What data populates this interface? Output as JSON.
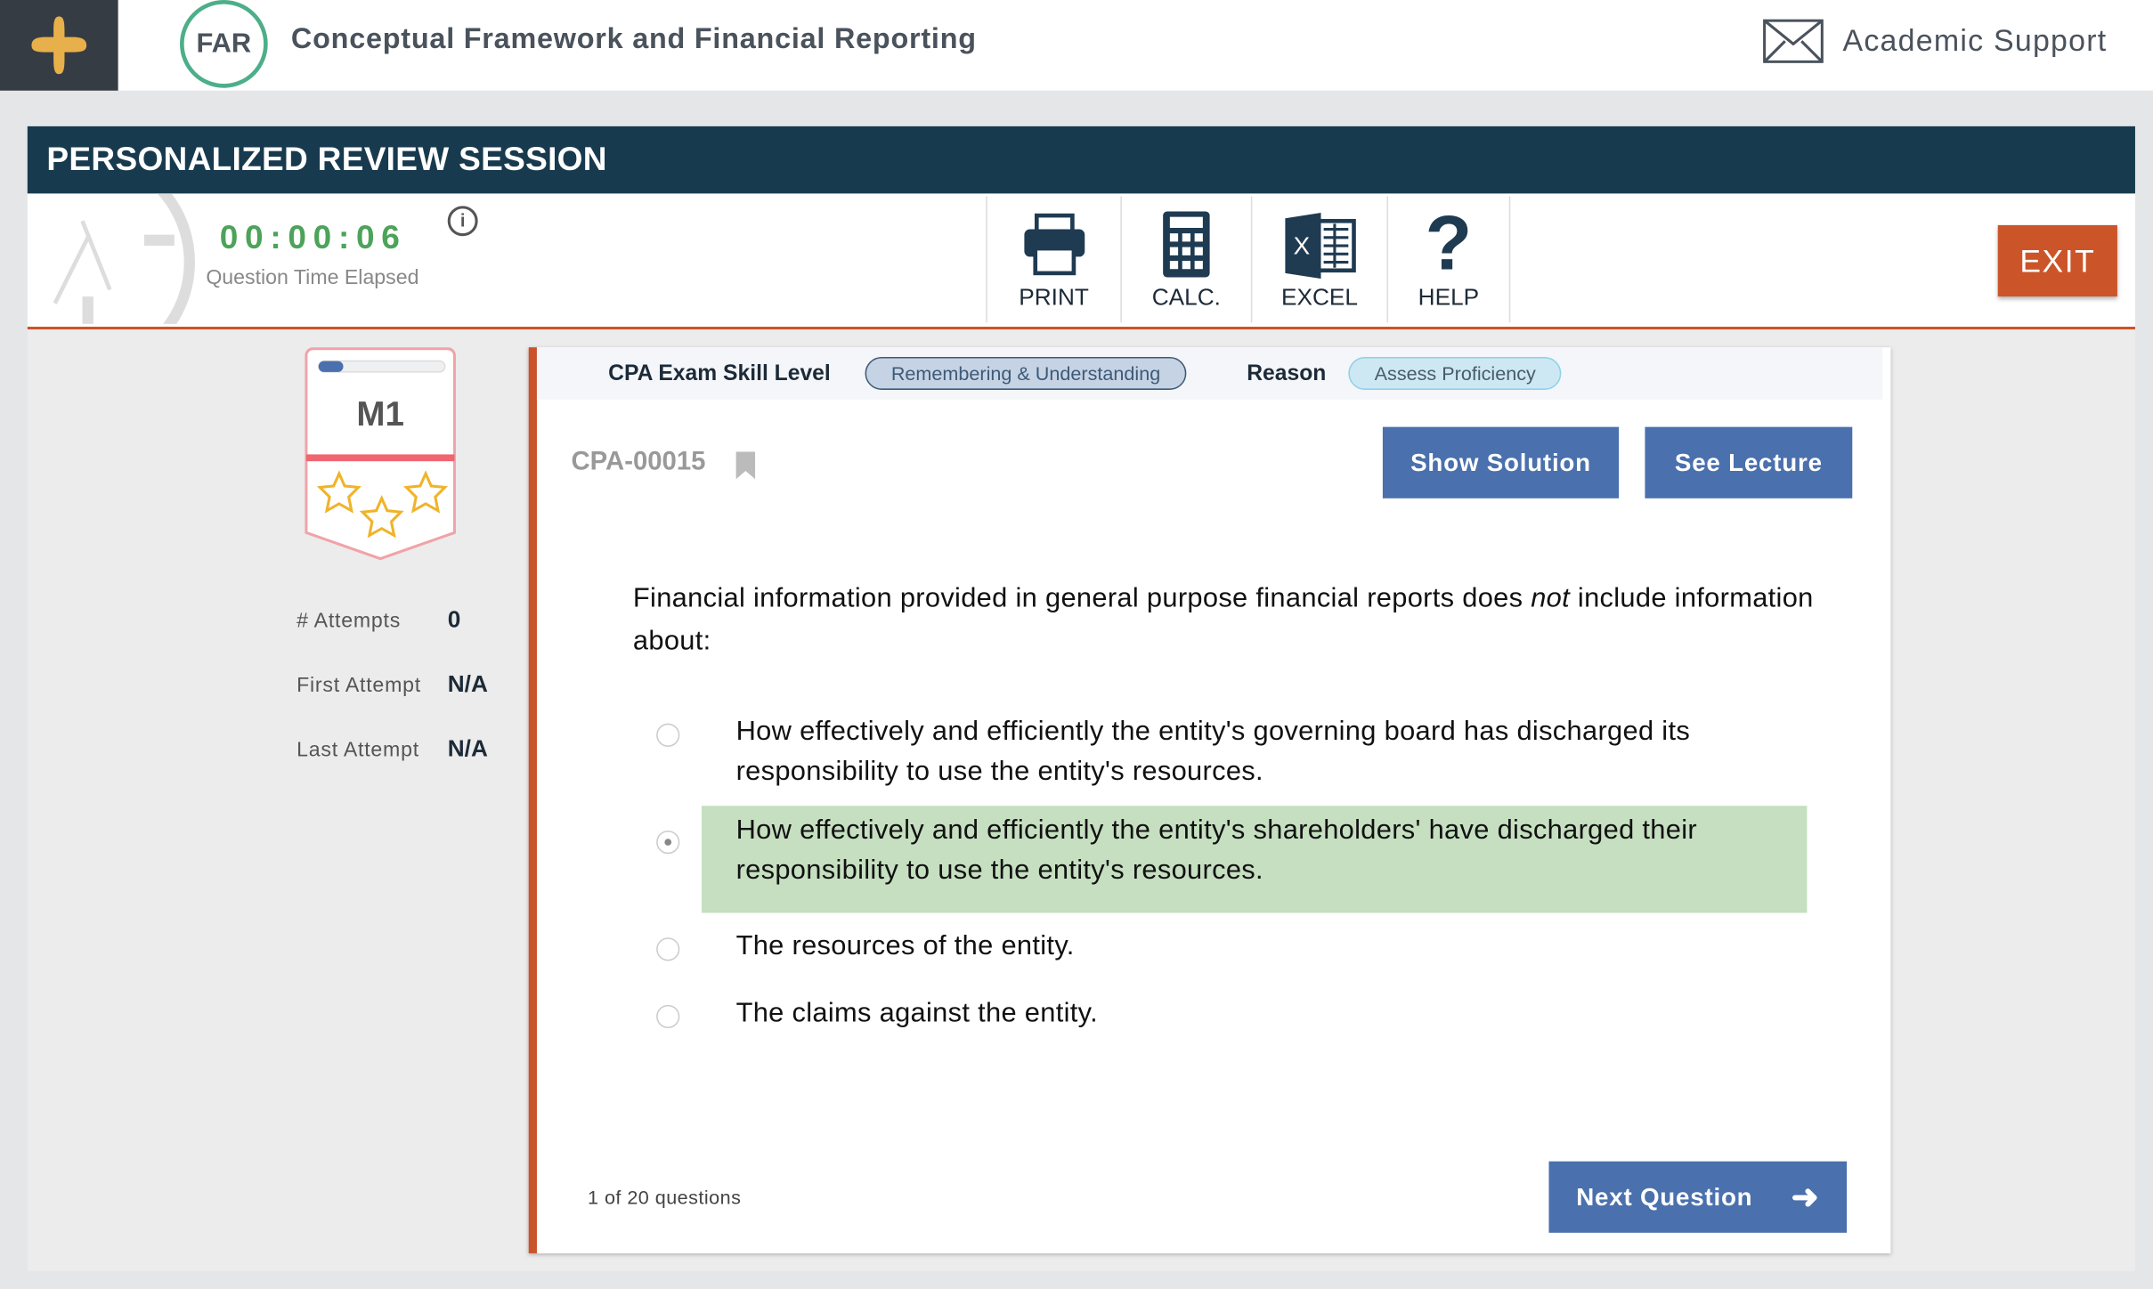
{
  "header": {
    "course_code": "FAR",
    "course_title": "Conceptual Framework and Financial Reporting",
    "support_label": "Academic Support"
  },
  "session": {
    "title": "PERSONALIZED REVIEW SESSION",
    "timer": "00:00:06",
    "timer_label": "Question Time Elapsed",
    "exit_label": "EXIT"
  },
  "tools": [
    {
      "label": "PRINT",
      "icon": "printer-icon"
    },
    {
      "label": "CALC.",
      "icon": "calculator-icon"
    },
    {
      "label": "EXCEL",
      "icon": "excel-icon"
    },
    {
      "label": "HELP",
      "icon": "help-icon"
    }
  ],
  "module": {
    "name": "M1",
    "progress": 0.05,
    "stars": 3,
    "attempts_label": "# Attempts",
    "attempts": "0",
    "first_label": "First Attempt",
    "first": "N/A",
    "last_label": "Last Attempt",
    "last": "N/A"
  },
  "question": {
    "skill_label": "CPA Exam Skill Level",
    "skill": "Remembering & Understanding",
    "reason_label": "Reason",
    "reason": "Assess Proficiency",
    "id": "CPA-00015",
    "show_solution": "Show Solution",
    "see_lecture": "See Lecture",
    "stem_before": "Financial information provided in general purpose financial reports does ",
    "stem_em": "not",
    "stem_after": " include information about:",
    "options": [
      {
        "text": "How effectively and efficiently the entity's governing board has discharged its responsibility to use the entity's resources.",
        "selected": false
      },
      {
        "text": "How effectively and efficiently the entity's shareholders' have discharged their responsibility to use the entity's resources.",
        "selected": true
      },
      {
        "text": "The resources of the entity.",
        "selected": false
      },
      {
        "text": "The claims against the entity.",
        "selected": false
      }
    ],
    "counter": "1 of 20 questions",
    "next_label": "Next Question"
  },
  "colors": {
    "accent": "#c9532b",
    "header": "#183a4e",
    "button": "#4a70ad",
    "selected": "#c5dfc0",
    "timer": "#4ca35a"
  }
}
